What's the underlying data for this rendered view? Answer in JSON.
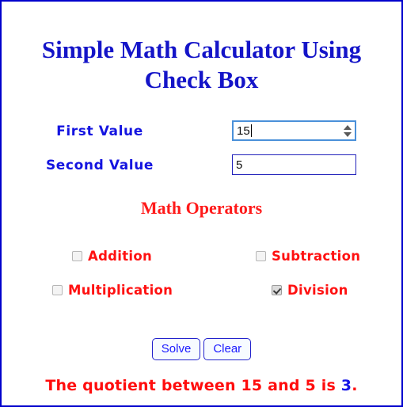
{
  "page": {
    "border_color": "#0000cc",
    "background": "#ffffff",
    "title_line1": "Simple Math Calculator Using",
    "title_line2": "Check Box",
    "title_color": "#1414c8"
  },
  "fields": {
    "first": {
      "label": "First Value",
      "value": "15",
      "placeholder": "",
      "type": "number",
      "focused": true,
      "has_spinner": true,
      "spin_up_icon": "triangle-up-icon",
      "spin_down_icon": "triangle-down-icon"
    },
    "second": {
      "label": "Second Value",
      "value": "5",
      "placeholder": "",
      "type": "text",
      "focused": false,
      "has_spinner": false
    },
    "label_color": "#1414e0",
    "input_border_color": "#2222bb",
    "focus_border_color": "#4a90d9"
  },
  "operators": {
    "heading": "Math Operators",
    "heading_color": "#ff1a1a",
    "label_color": "#ff1111",
    "items": [
      {
        "label": "Addition",
        "checked": false,
        "icon": "checkbox-unchecked-icon"
      },
      {
        "label": "Subtraction",
        "checked": false,
        "icon": "checkbox-unchecked-icon"
      },
      {
        "label": "Multiplication",
        "checked": false,
        "icon": "checkbox-unchecked-icon"
      },
      {
        "label": "Division",
        "checked": true,
        "icon": "checkbox-checked-icon"
      }
    ]
  },
  "buttons": {
    "solve_label": "Solve",
    "clear_label": "Clear",
    "text_color": "#1a1aff",
    "border_color": "#2222cc"
  },
  "result": {
    "prefix": "The quotient between 15 and 5 is ",
    "answer": "3",
    "suffix": ".",
    "text_color": "#ff0d0d",
    "answer_color": "#1414e6",
    "full_text": "The quotient between 15 and 5 is 3."
  }
}
